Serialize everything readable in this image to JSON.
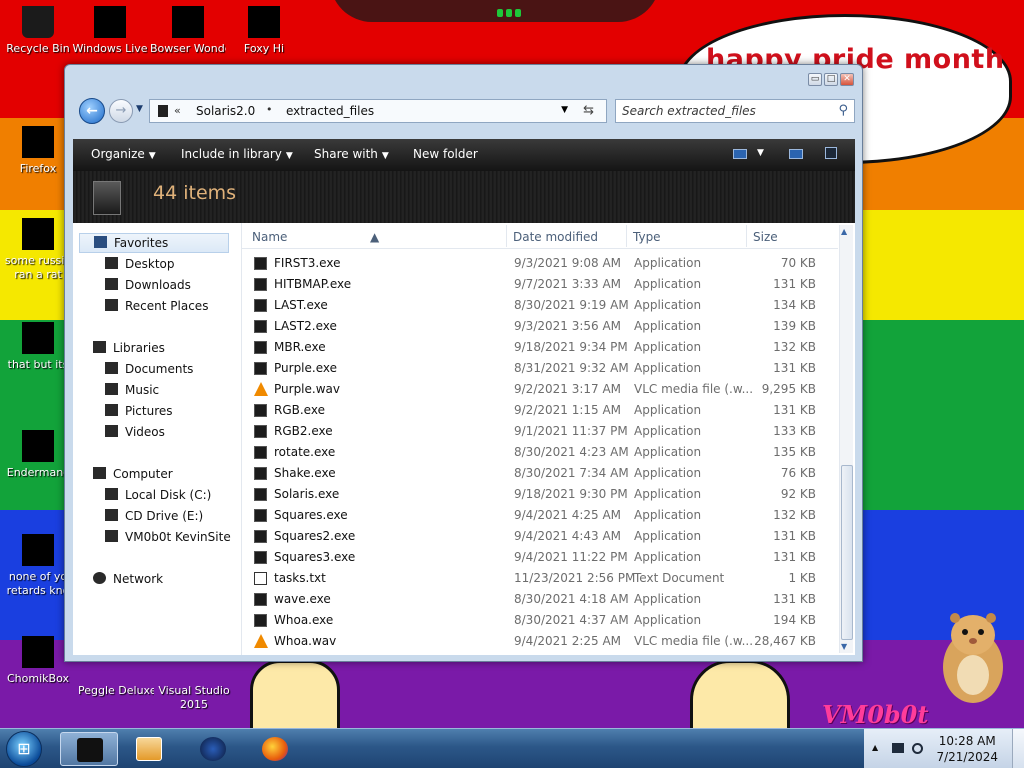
{
  "desktop": {
    "speech_text": "happy pride month",
    "logo_text": "VM0b0t",
    "icons": [
      {
        "label": "Recycle Bin",
        "label2": ""
      },
      {
        "label": "Windows Live",
        "label2": ""
      },
      {
        "label": "Bowser Wonder",
        "label2": ""
      },
      {
        "label": "Foxy Hi",
        "label2": ""
      },
      {
        "label": "Firefox",
        "label2": ""
      },
      {
        "label": "some russia",
        "label2": "ran a rat"
      },
      {
        "label": "that but its",
        "label2": ""
      },
      {
        "label": "Endermanc",
        "label2": ""
      },
      {
        "label": "none of yo",
        "label2": "retards kno"
      },
      {
        "label": "ChomikBox",
        "label2": ""
      },
      {
        "label": "Peggle Deluxe",
        "label2": ""
      },
      {
        "label": "Visual Studio",
        "label2": "2015"
      }
    ]
  },
  "window": {
    "controls": {
      "min": "▭",
      "max": "□",
      "close": "✕"
    },
    "address": {
      "crumbs": [
        "Solaris2.0",
        "extracted_files"
      ]
    },
    "search_placeholder": "Search extracted_files",
    "toolbar": {
      "organize": "Organize",
      "include": "Include in library",
      "share": "Share with",
      "new_folder": "New folder"
    },
    "item_count": "44 items",
    "nav": {
      "favorites": "Favorites",
      "desktop": "Desktop",
      "downloads": "Downloads",
      "recent": "Recent Places",
      "libraries": "Libraries",
      "documents": "Documents",
      "music": "Music",
      "pictures": "Pictures",
      "videos": "Videos",
      "computer": "Computer",
      "local_disk": "Local Disk (C:)",
      "cd_drive": "CD Drive (E:)",
      "vm_site": "VM0b0t KevinSite",
      "network": "Network"
    },
    "columns": {
      "name": "Name",
      "date": "Date modified",
      "type": "Type",
      "size": "Size"
    },
    "files": [
      {
        "name": "FIRST3.exe",
        "date": "9/3/2021 9:08 AM",
        "type": "Application",
        "size": "70 KB",
        "icon": "exe"
      },
      {
        "name": "HITBMAP.exe",
        "date": "9/7/2021 3:33 AM",
        "type": "Application",
        "size": "131 KB",
        "icon": "exe"
      },
      {
        "name": "LAST.exe",
        "date": "8/30/2021 9:19 AM",
        "type": "Application",
        "size": "134 KB",
        "icon": "exe"
      },
      {
        "name": "LAST2.exe",
        "date": "9/3/2021 3:56 AM",
        "type": "Application",
        "size": "139 KB",
        "icon": "exe"
      },
      {
        "name": "MBR.exe",
        "date": "9/18/2021 9:34 PM",
        "type": "Application",
        "size": "132 KB",
        "icon": "exe"
      },
      {
        "name": "Purple.exe",
        "date": "8/31/2021 9:32 AM",
        "type": "Application",
        "size": "131 KB",
        "icon": "exe"
      },
      {
        "name": "Purple.wav",
        "date": "9/2/2021 3:17 AM",
        "type": "VLC media file (.w...",
        "size": "9,295 KB",
        "icon": "vlc"
      },
      {
        "name": "RGB.exe",
        "date": "9/2/2021 1:15 AM",
        "type": "Application",
        "size": "131 KB",
        "icon": "exe"
      },
      {
        "name": "RGB2.exe",
        "date": "9/1/2021 11:37 PM",
        "type": "Application",
        "size": "133 KB",
        "icon": "exe"
      },
      {
        "name": "rotate.exe",
        "date": "8/30/2021 4:23 AM",
        "type": "Application",
        "size": "135 KB",
        "icon": "exe"
      },
      {
        "name": "Shake.exe",
        "date": "8/30/2021 7:34 AM",
        "type": "Application",
        "size": "76 KB",
        "icon": "exe"
      },
      {
        "name": "Solaris.exe",
        "date": "9/18/2021 9:30 PM",
        "type": "Application",
        "size": "92 KB",
        "icon": "exe"
      },
      {
        "name": "Squares.exe",
        "date": "9/4/2021 4:25 AM",
        "type": "Application",
        "size": "132 KB",
        "icon": "exe"
      },
      {
        "name": "Squares2.exe",
        "date": "9/4/2021 4:43 AM",
        "type": "Application",
        "size": "131 KB",
        "icon": "exe"
      },
      {
        "name": "Squares3.exe",
        "date": "9/4/2021 11:22 PM",
        "type": "Application",
        "size": "131 KB",
        "icon": "exe"
      },
      {
        "name": "tasks.txt",
        "date": "11/23/2021 2:56 PM",
        "type": "Text Document",
        "size": "1 KB",
        "icon": "txt"
      },
      {
        "name": "wave.exe",
        "date": "8/30/2021 4:18 AM",
        "type": "Application",
        "size": "131 KB",
        "icon": "exe"
      },
      {
        "name": "Whoa.exe",
        "date": "8/30/2021 4:37 AM",
        "type": "Application",
        "size": "194 KB",
        "icon": "exe"
      },
      {
        "name": "Whoa.wav",
        "date": "9/4/2021 2:25 AM",
        "type": "VLC media file (.w...",
        "size": "28,467 KB",
        "icon": "vlc"
      }
    ]
  },
  "taskbar": {
    "time": "10:28 AM",
    "date": "7/21/2024"
  },
  "colors": {
    "accent": "#2c5788",
    "count_text": "#e0b27a",
    "speech": "#d0101c"
  }
}
